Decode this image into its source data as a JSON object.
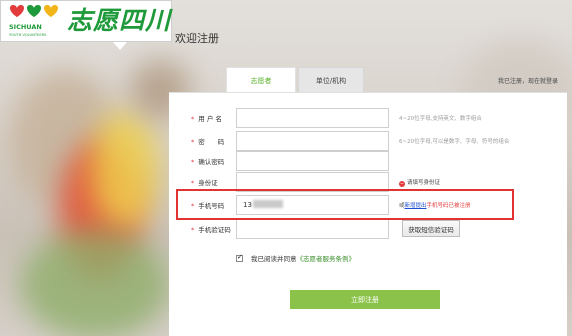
{
  "brand": {
    "name": "志愿四川",
    "tag_line1": "SICHUAN",
    "tag_line2": "YOUTH VOLUNTEERS"
  },
  "page": {
    "title": "欢迎注册"
  },
  "tabs": [
    {
      "label": "志愿者",
      "active": true
    },
    {
      "label": "单位/机构",
      "active": false
    }
  ],
  "top_link": "我已注册，现在就登录",
  "form": {
    "username": {
      "label": "用 户 名",
      "value": "",
      "hint": "4~20位字母,支持英文、数字组合"
    },
    "password": {
      "label": "密　　码",
      "value": "",
      "hint": "6~20位字母,可以是数字、字母、符号的组合"
    },
    "confirm": {
      "label": "确认密码",
      "value": ""
    },
    "id_card": {
      "label": "身份证",
      "value": "",
      "error": "请填写身份证"
    },
    "phone": {
      "label": "手机号码",
      "value_prefix": "13",
      "error_prefix": "或",
      "error_link": "新增提出",
      "error_text": "手机号码已被注册"
    },
    "sms_code": {
      "label": "手机验证码",
      "value": "",
      "button": "获取短信验证码"
    }
  },
  "agreement": {
    "checked": true,
    "text": "我已阅读并同意",
    "policy": "《志愿者服务条例》"
  },
  "submit_label": "立即注册",
  "colors": {
    "accent_green": "#5db42d",
    "button_green": "#8bc34a",
    "error_red": "#e23c3c",
    "highlight_red": "#e23333"
  }
}
